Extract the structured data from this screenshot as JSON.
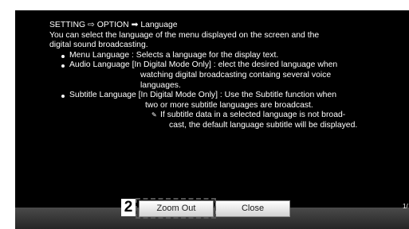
{
  "breadcrumb": {
    "part1": "SETTING",
    "part2": "OPTION",
    "part3": "Language"
  },
  "intro": [
    "You can select the language of the menu displayed on the screen and the",
    "digital sound broadcasting."
  ],
  "items": {
    "menu": "Menu Language : Selects a language for the display text.",
    "audio": [
      "Audio Language  [In Digital Mode Only] : elect the desired language when",
      "watching digital broadcasting containg several voice",
      "languages."
    ],
    "subtitle": [
      "Subtitle Language [In Digital Mode Only] : Use the Subtitle function when",
      "two or more subtitle languages are broadcast."
    ]
  },
  "note": [
    "If subtitle data in a selected language is not broad-",
    "cast, the default language subtitle will be displayed."
  ],
  "footer": {
    "step": "2",
    "zoom_out": "Zoom Out",
    "close": "Close",
    "page": "1/"
  },
  "colors": {
    "screen_bg": "#000000",
    "text": "#ffffff",
    "button_bg": "#e8e8e8"
  }
}
